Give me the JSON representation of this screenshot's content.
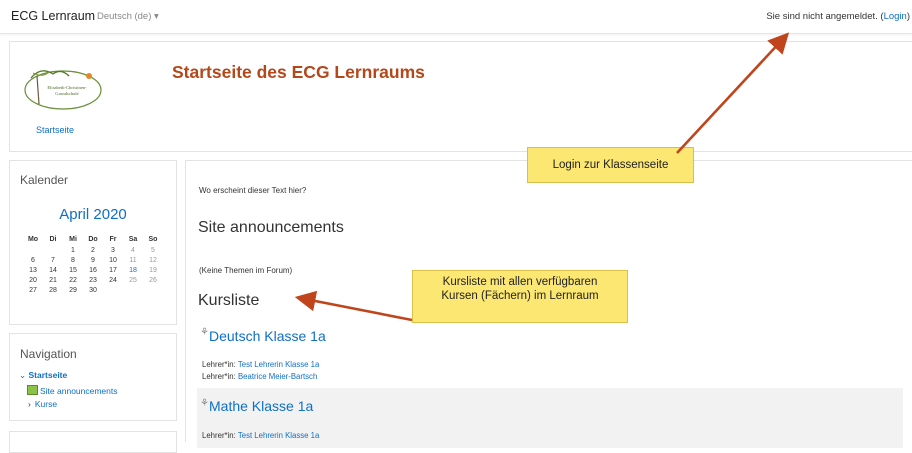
{
  "topbar": {
    "brand": "ECG Lernraum",
    "language": "Deutsch (de)",
    "lang_caret": "▾",
    "status_text": "Sie sind nicht angemeldet. (",
    "login_link": "Login",
    "status_close": ")"
  },
  "header": {
    "logo_text_1": "Elisabeth-Christinen-",
    "logo_text_2": "Grundschule",
    "page_title": "Startseite des ECG Lernraums",
    "breadcrumb": "Startseite"
  },
  "calendar": {
    "title": "Kalender",
    "month": "April 2020",
    "weekdays": [
      "Mo",
      "Di",
      "Mi",
      "Do",
      "Fr",
      "Sa",
      "So"
    ],
    "weeks": [
      [
        "",
        "",
        "1",
        "2",
        "3",
        "4",
        "5"
      ],
      [
        "6",
        "7",
        "8",
        "9",
        "10",
        "11",
        "12"
      ],
      [
        "13",
        "14",
        "15",
        "16",
        "17",
        "18",
        "19"
      ],
      [
        "20",
        "21",
        "22",
        "23",
        "24",
        "25",
        "26"
      ],
      [
        "27",
        "28",
        "29",
        "30",
        "",
        "",
        ""
      ]
    ],
    "highlighted_day": "18"
  },
  "navigation": {
    "title": "Navigation",
    "home_caret": "⌄",
    "home": "Startseite",
    "site_announcements": "Site announcements",
    "courses_caret": "›",
    "courses": "Kurse"
  },
  "main": {
    "intro_text": "Wo erscheint dieser Text hier?",
    "announcements_heading": "Site announcements",
    "no_topics": "(Keine Themen im Forum)",
    "course_list_heading": "Kursliste",
    "teacher_label": "Lehrer*in:",
    "courses": [
      {
        "name": "Deutsch Klasse 1a",
        "teachers": [
          "Test Lehrerin Klasse 1a",
          "Beatrice Meier-Bartsch"
        ]
      },
      {
        "name": "Mathe Klasse 1a",
        "teachers": [
          "Test Lehrerin Klasse 1a"
        ]
      }
    ]
  },
  "annotations": {
    "login_note": "Login zur Klassenseite",
    "courselist_note_1": "Kursliste mit allen verfügbaren",
    "courselist_note_2": "Kursen (Fächern) im Lernraum",
    "note_color": "#fbe772",
    "arrow_color": "#c0451c"
  }
}
